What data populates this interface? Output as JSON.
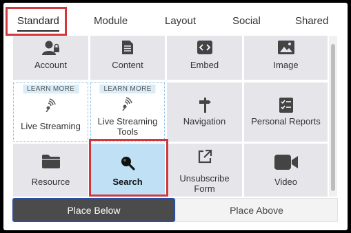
{
  "tabs": [
    "Standard",
    "Module",
    "Layout",
    "Social",
    "Shared"
  ],
  "active_tab": "Standard",
  "learn_more_label": "LEARN MORE",
  "tiles": {
    "account": "Account",
    "content": "Content",
    "embed": "Embed",
    "image": "Image",
    "live_streaming": "Live Streaming",
    "live_streaming_tools": "Live Streaming Tools",
    "navigation": "Navigation",
    "personal_reports": "Personal Reports",
    "resource": "Resource",
    "search": "Search",
    "unsubscribe_form": "Unsubscribe Form",
    "video": "Video"
  },
  "selected_tile": "Search",
  "placement": {
    "below": "Place Below",
    "above": "Place Above",
    "selected": "Place Below"
  },
  "colors": {
    "highlight": "#d0393c",
    "selected_tile": "#bfe0f5",
    "tile": "#e6e6ea",
    "active_button": "#4b4b4b"
  }
}
